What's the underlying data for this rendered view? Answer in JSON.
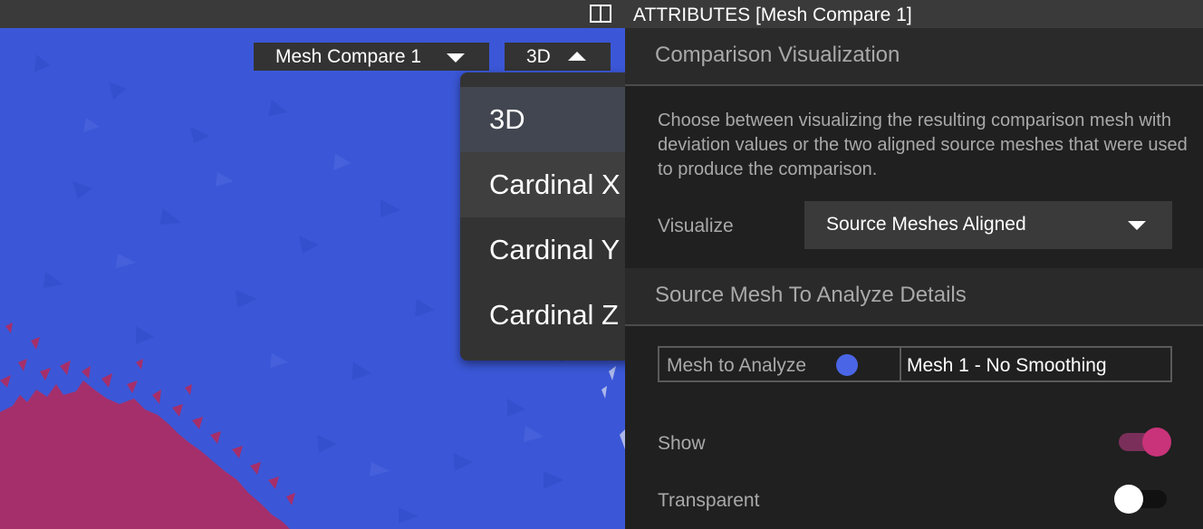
{
  "colors": {
    "viewport_blue": "#3b57d7",
    "mesh_magenta": "#a52f6a",
    "mesh_dot": "#4a66e6",
    "toggle_on": "#c9337a",
    "panel_bg": "#202020"
  },
  "viewport": {
    "layout_icon": "split-view-icon",
    "mesh_selector": {
      "value": "Mesh Compare 1",
      "icon": "caret-down-icon"
    },
    "view_selector": {
      "value": "3D",
      "icon": "caret-up-icon"
    },
    "view_menu": {
      "items": [
        {
          "label": "3D",
          "selected": true
        },
        {
          "label": "Cardinal X",
          "hovered": true
        },
        {
          "label": "Cardinal Y"
        },
        {
          "label": "Cardinal Z"
        }
      ]
    }
  },
  "panel": {
    "header": "ATTRIBUTES [Mesh Compare 1]",
    "comparison": {
      "title": "Comparison Visualization",
      "description": "Choose between visualizing the resulting comparison mesh with deviation values or the two aligned source meshes that were used to produce the comparison.",
      "visualize_label": "Visualize",
      "visualize_value": "Source Meshes Aligned"
    },
    "source_mesh": {
      "title": "Source Mesh To Analyze Details",
      "analyze_label": "Mesh to Analyze",
      "analyze_value": "Mesh 1 - No Smoothing",
      "show_label": "Show",
      "show_on": true,
      "transparent_label": "Transparent",
      "transparent_on": false
    }
  }
}
